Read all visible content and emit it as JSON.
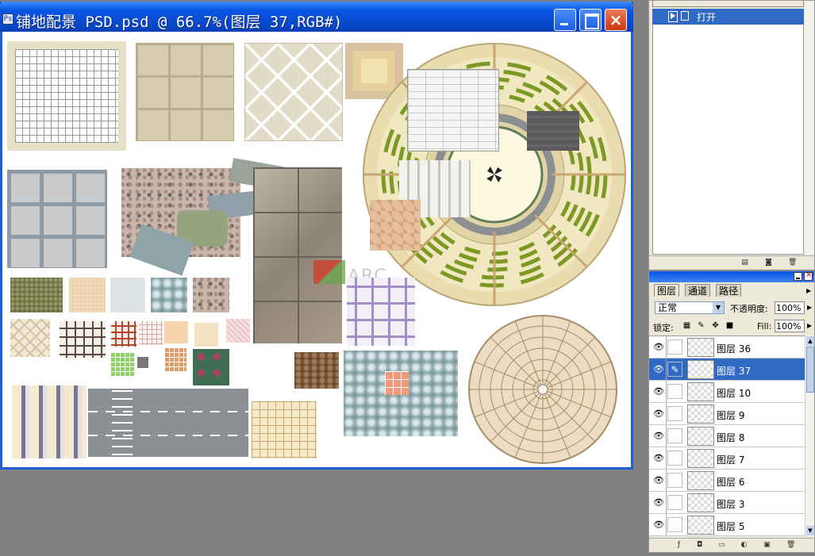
{
  "document": {
    "title": "铺地配景 PSD.psd @ 66.7%(图层 37,RGB#)",
    "icon_label": "Ps",
    "controls": {
      "minimize": "minimize-icon",
      "maximize": "maximize-icon",
      "close": "×"
    },
    "watermark": "ARC"
  },
  "history_panel": {
    "step": "打开"
  },
  "layers_panel": {
    "tabs": [
      "图层",
      "通道",
      "路径"
    ],
    "blend_mode": "正常",
    "opacity_label": "不透明度:",
    "opacity_value": "100%",
    "lock_label": "锁定:",
    "fill_label": "Fill:",
    "fill_value": "100%",
    "layers": [
      {
        "name": "图层 36",
        "selected": false
      },
      {
        "name": "图层 37",
        "selected": true
      },
      {
        "name": "图层 10",
        "selected": false
      },
      {
        "name": "图层 9",
        "selected": false
      },
      {
        "name": "图层 8",
        "selected": false
      },
      {
        "name": "图层 7",
        "selected": false
      },
      {
        "name": "图层 6",
        "selected": false
      },
      {
        "name": "图层 3",
        "selected": false
      },
      {
        "name": "图层 5",
        "selected": false
      }
    ]
  },
  "colors": {
    "titlebar": "#0a55e3",
    "selection": "#316ac5",
    "workspace": "#808080",
    "panel": "#ece9d8"
  }
}
